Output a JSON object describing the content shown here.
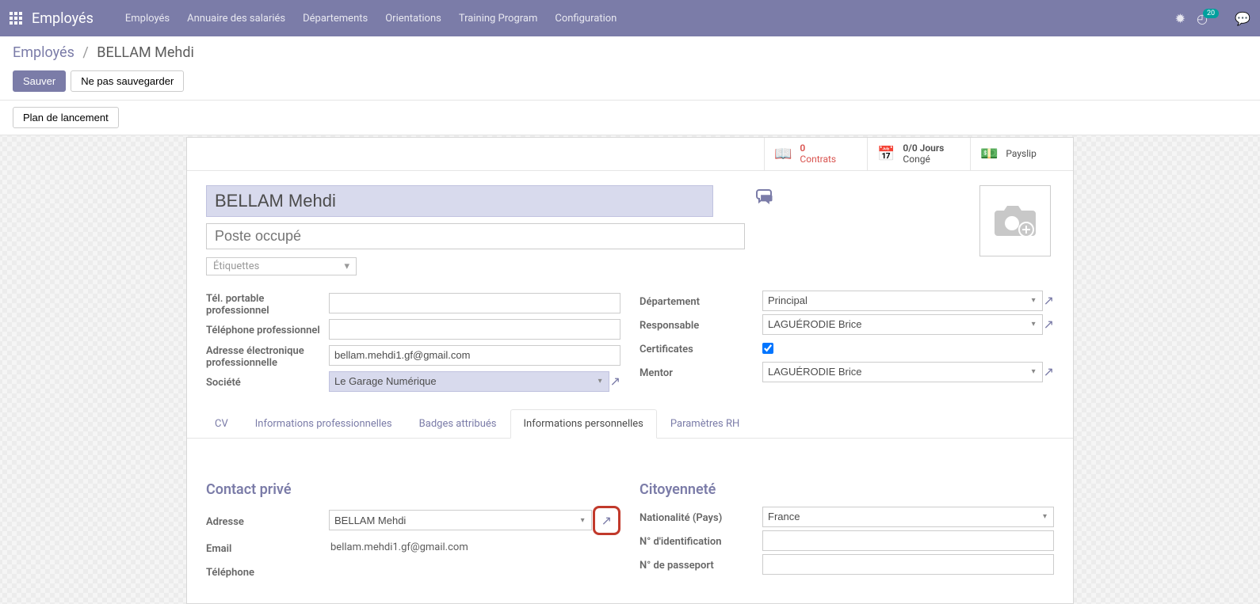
{
  "topbar": {
    "brand": "Employés",
    "menu": [
      "Employés",
      "Annuaire des salariés",
      "Départements",
      "Orientations",
      "Training Program",
      "Configuration"
    ],
    "badge_count": "20"
  },
  "breadcrumb": {
    "root": "Employés",
    "current": "BELLAM Mehdi"
  },
  "buttons": {
    "save": "Sauver",
    "discard": "Ne pas sauvegarder",
    "launch_plan": "Plan de lancement"
  },
  "stats": {
    "contracts_num": "0",
    "contracts_label": "Contrats",
    "leave_num": "0/0 Jours",
    "leave_label": "Congé",
    "payslip_label": "Payslip"
  },
  "form": {
    "name": "BELLAM Mehdi",
    "job_placeholder": "Poste occupé",
    "tags_placeholder": "Étiquettes",
    "labels": {
      "mobile": "Tél. portable professionnel",
      "phone": "Téléphone professionnel",
      "email": "Adresse électronique professionnelle",
      "company": "Société",
      "dept": "Département",
      "manager": "Responsable",
      "certs": "Certificates",
      "mentor": "Mentor"
    },
    "values": {
      "mobile": "",
      "phone": "",
      "email": "bellam.mehdi1.gf@gmail.com",
      "company": "Le Garage Numérique",
      "dept": "Principal",
      "manager": "LAGUÉRODIE Brice",
      "mentor": "LAGUÉRODIE Brice"
    }
  },
  "tabs": [
    "CV",
    "Informations professionnelles",
    "Badges attribués",
    "Informations personnelles",
    "Paramètres RH"
  ],
  "personal": {
    "section_contact": "Contact privé",
    "section_citizen": "Citoyenneté",
    "labels": {
      "address": "Adresse",
      "email": "Email",
      "phone": "Téléphone",
      "nationality": "Nationalité (Pays)",
      "ident": "N° d'identification",
      "passport": "N° de passeport"
    },
    "values": {
      "address": "BELLAM Mehdi",
      "email": "bellam.mehdi1.gf@gmail.com",
      "nationality": "France"
    }
  }
}
